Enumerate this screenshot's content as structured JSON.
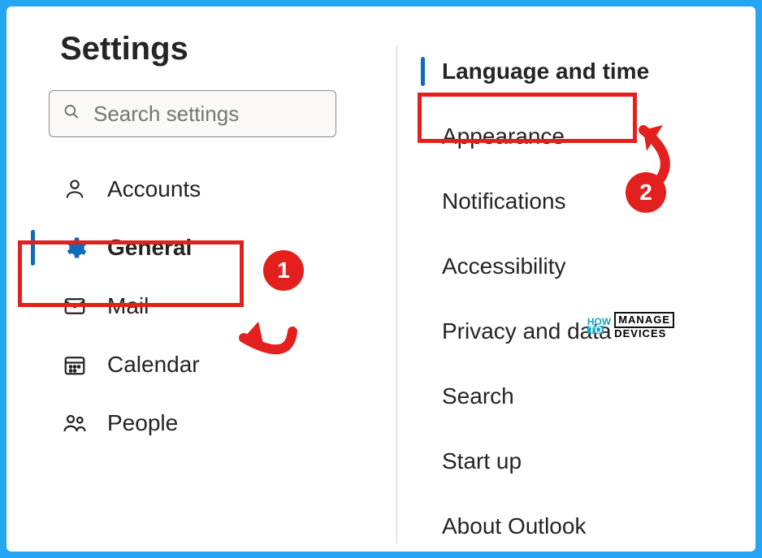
{
  "page": {
    "title": "Settings"
  },
  "search": {
    "placeholder": "Search settings"
  },
  "nav": {
    "accounts": "Accounts",
    "general": "General",
    "mail": "Mail",
    "calendar": "Calendar",
    "people": "People"
  },
  "sub": {
    "language_time": "Language and time",
    "appearance": "Appearance",
    "notifications": "Notifications",
    "accessibility": "Accessibility",
    "privacy": "Privacy and data",
    "search": "Search",
    "startup": "Start up",
    "about": "About Outlook"
  },
  "annotations": {
    "badge1": "1",
    "badge2": "2"
  },
  "watermark": {
    "line1a": "HOW",
    "line1b": "TO",
    "box": "MANAGE",
    "line2": "DEVICES"
  }
}
